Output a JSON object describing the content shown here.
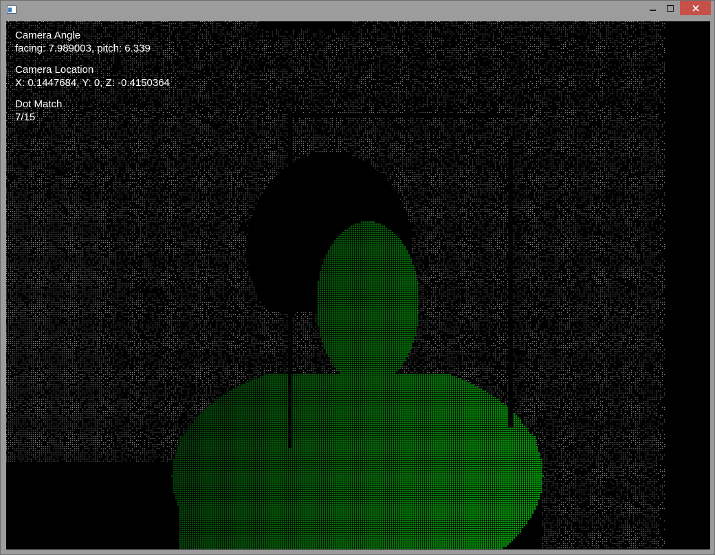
{
  "window": {
    "title": "",
    "controls": {
      "minimize": "minimize",
      "maximize": "maximize",
      "close": "close"
    },
    "colors": {
      "frame": "#9c9c9c",
      "close_button": "#c7504a",
      "viewport_background": "#000000",
      "point_cloud_background": "#ffffff",
      "point_cloud_person": "#1fbf2a"
    }
  },
  "overlay": {
    "camera_angle_label": "Camera Angle",
    "camera_angle_value": "facing: 7.989003, pitch: 6.339",
    "camera_location_label": "Camera Location",
    "camera_location_value": "X: 0.1447684, Y: 0, Z: -0.4150364",
    "dot_match_label": "Dot Match",
    "dot_match_value": "7/15"
  }
}
